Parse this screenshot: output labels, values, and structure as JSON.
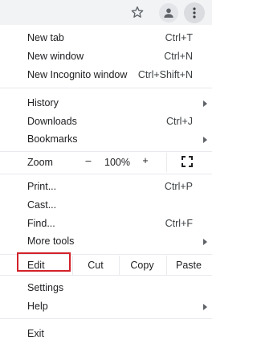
{
  "toolbar": {
    "icons": [
      "star-icon",
      "profile-icon",
      "more-vert-icon"
    ]
  },
  "menu": {
    "group1": [
      {
        "label": "New tab",
        "shortcut": "Ctrl+T"
      },
      {
        "label": "New window",
        "shortcut": "Ctrl+N"
      },
      {
        "label": "New Incognito window",
        "shortcut": "Ctrl+Shift+N"
      }
    ],
    "group2": [
      {
        "label": "History",
        "submenu": true
      },
      {
        "label": "Downloads",
        "shortcut": "Ctrl+J"
      },
      {
        "label": "Bookmarks",
        "submenu": true
      }
    ],
    "zoom": {
      "label": "Zoom",
      "minus": "–",
      "value": "100%",
      "plus": "+",
      "fullscreen_icon": "fullscreen-icon"
    },
    "group3": [
      {
        "label": "Print...",
        "shortcut": "Ctrl+P"
      },
      {
        "label": "Cast..."
      },
      {
        "label": "Find...",
        "shortcut": "Ctrl+F"
      },
      {
        "label": "More tools",
        "submenu": true
      }
    ],
    "edit": {
      "label": "Edit",
      "cut": "Cut",
      "copy": "Copy",
      "paste": "Paste"
    },
    "group4": [
      {
        "label": "Settings"
      },
      {
        "label": "Help",
        "submenu": true
      }
    ],
    "group5": [
      {
        "label": "Exit"
      }
    ]
  },
  "highlight_color": "#d3222a"
}
